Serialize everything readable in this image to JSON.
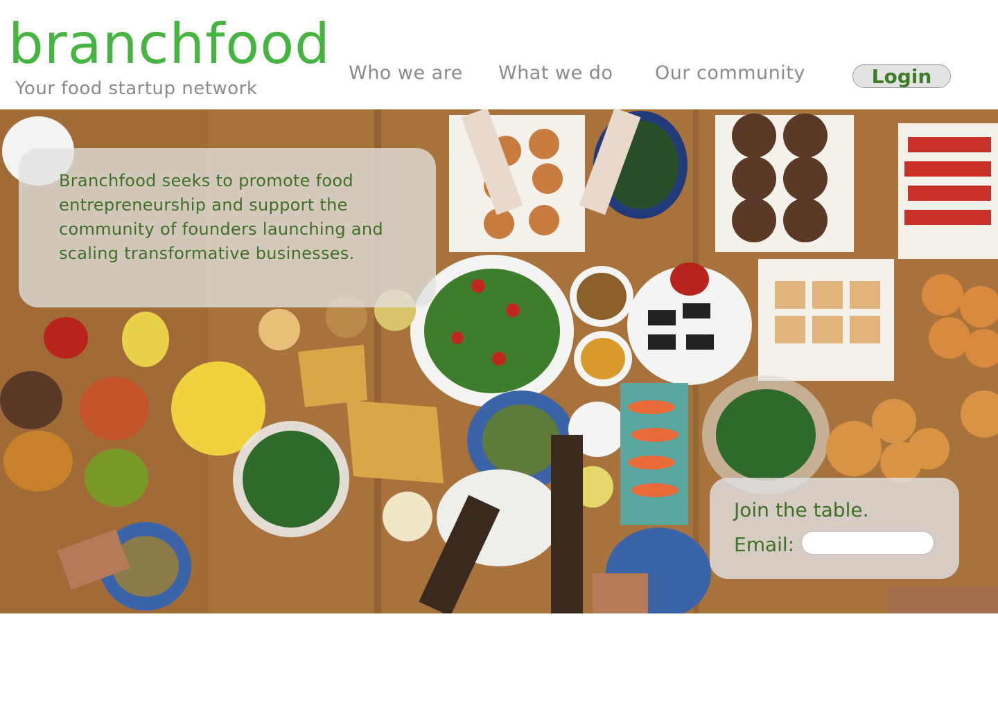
{
  "brand": {
    "logo": "branchfood",
    "tagline": "Your food startup network"
  },
  "nav": {
    "items": [
      {
        "label": "Who we are"
      },
      {
        "label": "What we do"
      },
      {
        "label": "Our community"
      }
    ],
    "login_label": "Login"
  },
  "hero": {
    "image": "overhead-table-spread-photo",
    "mission": "Branchfood seeks to promote food entrepreneurship and support the community of founders launching and scaling transformative businesses."
  },
  "signup": {
    "title": "Join the table.",
    "email_label": "Email:",
    "email_value": "",
    "email_placeholder": ""
  },
  "colors": {
    "brand_green": "#46b441",
    "text_green": "#3f6f28",
    "nav_gray": "#8a8a8a"
  }
}
